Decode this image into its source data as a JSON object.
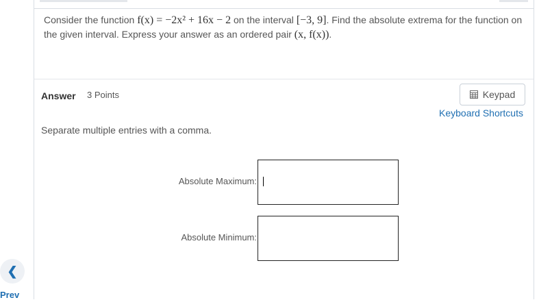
{
  "nav": {
    "prev_icon": "chevron-left-icon",
    "prev_label": "Prev"
  },
  "question": {
    "intro": "Consider the function ",
    "function_math": "f(x) = −2x² + 16x − 2",
    "interval_intro": " on the interval ",
    "interval_math": "[−3, 9]",
    "task": ". Find the absolute extrema for the function on the given interval. Express your answer as an ordered pair ",
    "pair_math": "(x, f(x))",
    "end": "."
  },
  "answer": {
    "title": "Answer",
    "points": "3 Points",
    "keypad_label": "Keypad",
    "keypad_icon": "keypad-icon",
    "shortcuts_label": "Keyboard Shortcuts",
    "instructions": "Separate multiple entries with a comma.",
    "max_label": "Absolute Maximum:",
    "max_value": "",
    "min_label": "Absolute Minimum:",
    "min_value": ""
  },
  "colors": {
    "link": "#1f6fb2",
    "border": "#d8dde3",
    "text": "#555555"
  }
}
